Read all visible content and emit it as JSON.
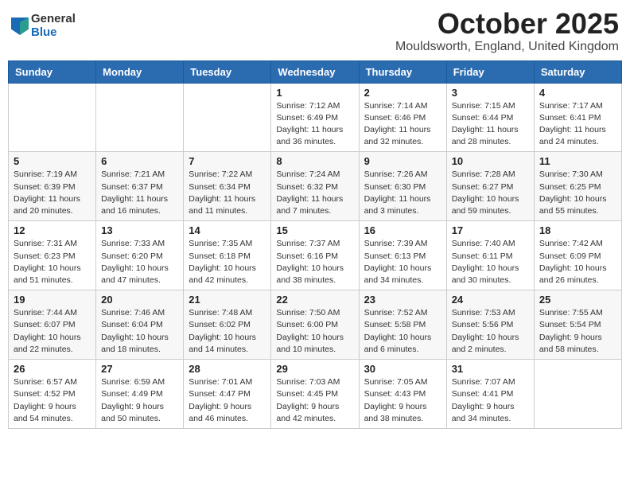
{
  "logo": {
    "general": "General",
    "blue": "Blue"
  },
  "header": {
    "title": "October 2025",
    "subtitle": "Mouldsworth, England, United Kingdom"
  },
  "days_of_week": [
    "Sunday",
    "Monday",
    "Tuesday",
    "Wednesday",
    "Thursday",
    "Friday",
    "Saturday"
  ],
  "weeks": [
    [
      {
        "day": "",
        "detail": ""
      },
      {
        "day": "",
        "detail": ""
      },
      {
        "day": "",
        "detail": ""
      },
      {
        "day": "1",
        "detail": "Sunrise: 7:12 AM\nSunset: 6:49 PM\nDaylight: 11 hours and 36 minutes."
      },
      {
        "day": "2",
        "detail": "Sunrise: 7:14 AM\nSunset: 6:46 PM\nDaylight: 11 hours and 32 minutes."
      },
      {
        "day": "3",
        "detail": "Sunrise: 7:15 AM\nSunset: 6:44 PM\nDaylight: 11 hours and 28 minutes."
      },
      {
        "day": "4",
        "detail": "Sunrise: 7:17 AM\nSunset: 6:41 PM\nDaylight: 11 hours and 24 minutes."
      }
    ],
    [
      {
        "day": "5",
        "detail": "Sunrise: 7:19 AM\nSunset: 6:39 PM\nDaylight: 11 hours and 20 minutes."
      },
      {
        "day": "6",
        "detail": "Sunrise: 7:21 AM\nSunset: 6:37 PM\nDaylight: 11 hours and 16 minutes."
      },
      {
        "day": "7",
        "detail": "Sunrise: 7:22 AM\nSunset: 6:34 PM\nDaylight: 11 hours and 11 minutes."
      },
      {
        "day": "8",
        "detail": "Sunrise: 7:24 AM\nSunset: 6:32 PM\nDaylight: 11 hours and 7 minutes."
      },
      {
        "day": "9",
        "detail": "Sunrise: 7:26 AM\nSunset: 6:30 PM\nDaylight: 11 hours and 3 minutes."
      },
      {
        "day": "10",
        "detail": "Sunrise: 7:28 AM\nSunset: 6:27 PM\nDaylight: 10 hours and 59 minutes."
      },
      {
        "day": "11",
        "detail": "Sunrise: 7:30 AM\nSunset: 6:25 PM\nDaylight: 10 hours and 55 minutes."
      }
    ],
    [
      {
        "day": "12",
        "detail": "Sunrise: 7:31 AM\nSunset: 6:23 PM\nDaylight: 10 hours and 51 minutes."
      },
      {
        "day": "13",
        "detail": "Sunrise: 7:33 AM\nSunset: 6:20 PM\nDaylight: 10 hours and 47 minutes."
      },
      {
        "day": "14",
        "detail": "Sunrise: 7:35 AM\nSunset: 6:18 PM\nDaylight: 10 hours and 42 minutes."
      },
      {
        "day": "15",
        "detail": "Sunrise: 7:37 AM\nSunset: 6:16 PM\nDaylight: 10 hours and 38 minutes."
      },
      {
        "day": "16",
        "detail": "Sunrise: 7:39 AM\nSunset: 6:13 PM\nDaylight: 10 hours and 34 minutes."
      },
      {
        "day": "17",
        "detail": "Sunrise: 7:40 AM\nSunset: 6:11 PM\nDaylight: 10 hours and 30 minutes."
      },
      {
        "day": "18",
        "detail": "Sunrise: 7:42 AM\nSunset: 6:09 PM\nDaylight: 10 hours and 26 minutes."
      }
    ],
    [
      {
        "day": "19",
        "detail": "Sunrise: 7:44 AM\nSunset: 6:07 PM\nDaylight: 10 hours and 22 minutes."
      },
      {
        "day": "20",
        "detail": "Sunrise: 7:46 AM\nSunset: 6:04 PM\nDaylight: 10 hours and 18 minutes."
      },
      {
        "day": "21",
        "detail": "Sunrise: 7:48 AM\nSunset: 6:02 PM\nDaylight: 10 hours and 14 minutes."
      },
      {
        "day": "22",
        "detail": "Sunrise: 7:50 AM\nSunset: 6:00 PM\nDaylight: 10 hours and 10 minutes."
      },
      {
        "day": "23",
        "detail": "Sunrise: 7:52 AM\nSunset: 5:58 PM\nDaylight: 10 hours and 6 minutes."
      },
      {
        "day": "24",
        "detail": "Sunrise: 7:53 AM\nSunset: 5:56 PM\nDaylight: 10 hours and 2 minutes."
      },
      {
        "day": "25",
        "detail": "Sunrise: 7:55 AM\nSunset: 5:54 PM\nDaylight: 9 hours and 58 minutes."
      }
    ],
    [
      {
        "day": "26",
        "detail": "Sunrise: 6:57 AM\nSunset: 4:52 PM\nDaylight: 9 hours and 54 minutes."
      },
      {
        "day": "27",
        "detail": "Sunrise: 6:59 AM\nSunset: 4:49 PM\nDaylight: 9 hours and 50 minutes."
      },
      {
        "day": "28",
        "detail": "Sunrise: 7:01 AM\nSunset: 4:47 PM\nDaylight: 9 hours and 46 minutes."
      },
      {
        "day": "29",
        "detail": "Sunrise: 7:03 AM\nSunset: 4:45 PM\nDaylight: 9 hours and 42 minutes."
      },
      {
        "day": "30",
        "detail": "Sunrise: 7:05 AM\nSunset: 4:43 PM\nDaylight: 9 hours and 38 minutes."
      },
      {
        "day": "31",
        "detail": "Sunrise: 7:07 AM\nSunset: 4:41 PM\nDaylight: 9 hours and 34 minutes."
      },
      {
        "day": "",
        "detail": ""
      }
    ]
  ]
}
